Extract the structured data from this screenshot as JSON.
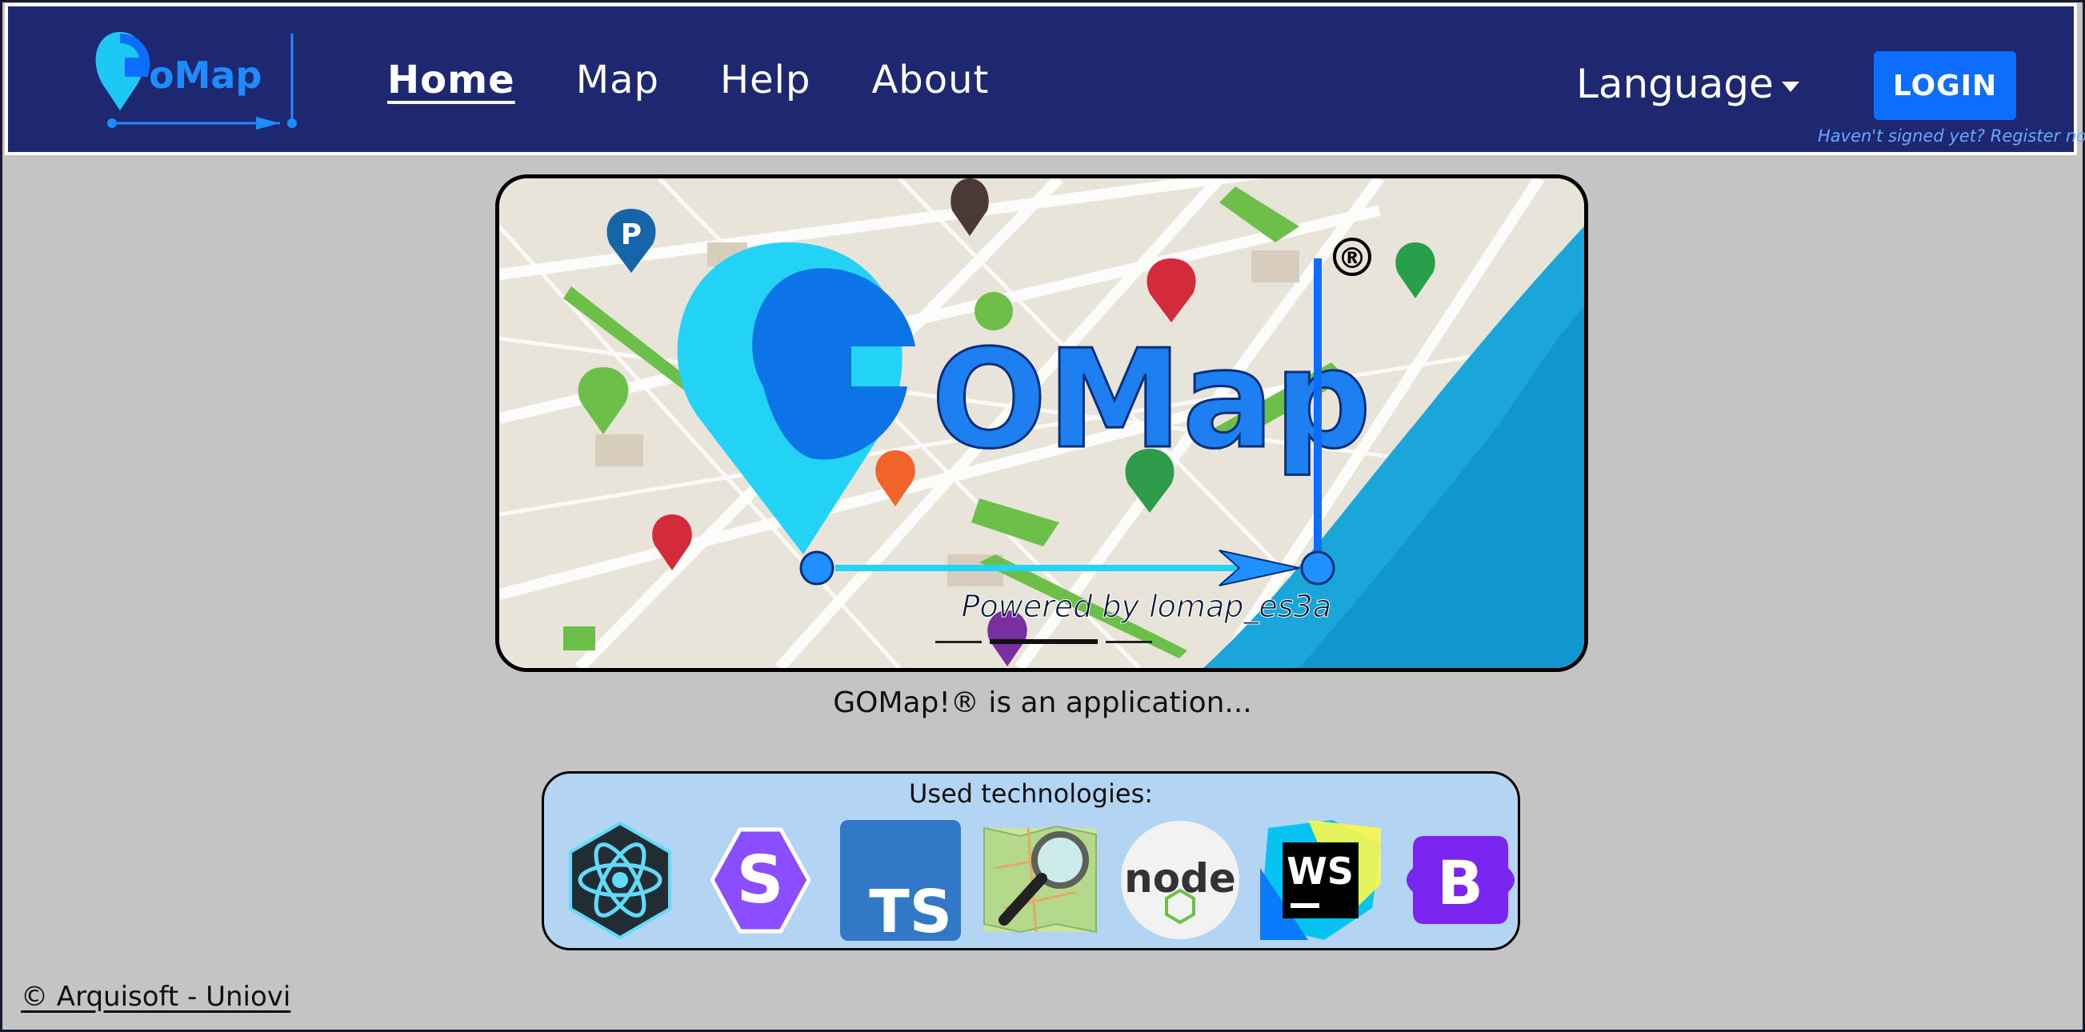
{
  "header": {
    "logo_text": "GOMap",
    "nav": [
      {
        "label": "Home",
        "active": true
      },
      {
        "label": "Map",
        "active": false
      },
      {
        "label": "Help",
        "active": false
      },
      {
        "label": "About",
        "active": false
      }
    ],
    "language_label": "Language",
    "login_label": "LOGIN",
    "register_hint": "Haven't signed yet? Register now!"
  },
  "carousel": {
    "logo_text": "GOMap",
    "registered_mark": "®",
    "powered_by": "Powered by lomap_es3a",
    "indicators": 3,
    "active_indicator": 2
  },
  "caption": "GOMap!® is an application...",
  "technologies": {
    "title": "Used technologies:",
    "items": [
      {
        "name": "react-icon",
        "text": ""
      },
      {
        "name": "solid-icon",
        "text": "S"
      },
      {
        "name": "typescript-icon",
        "text": "TS"
      },
      {
        "name": "openstreetmap-icon",
        "text": ""
      },
      {
        "name": "nodejs-icon",
        "text": "node"
      },
      {
        "name": "webstorm-icon",
        "text": "WS"
      },
      {
        "name": "bootstrap-icon",
        "text": "B"
      }
    ]
  },
  "footer": {
    "text": "© Arquisoft - Uniovi"
  },
  "colors": {
    "header_bg": "#1d2870",
    "login_bg": "#0d6efd",
    "page_bg": "#c4c4c4",
    "tech_bg": "#b3d4f2"
  }
}
